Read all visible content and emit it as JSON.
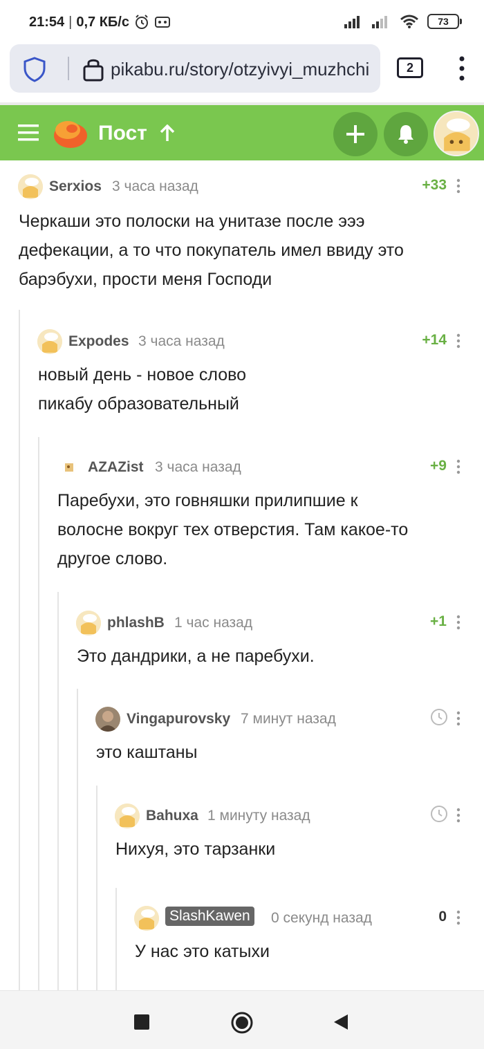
{
  "status_bar": {
    "time": "21:54",
    "speed": "0,7 КБ/с",
    "battery": "73"
  },
  "browser": {
    "url": "pikabu.ru/story/otzyivyi_muzhchi",
    "tab_count": "2"
  },
  "header": {
    "title": "Пост",
    "accent_color": "#7ac74f"
  },
  "comments": [
    {
      "author": "Serxios",
      "time": "3 часа назад",
      "rating": "+33",
      "lines": [
        "Черкаши это полоски на унитазе после эээ",
        "дефекации, а то что покупатель имел ввиду это",
        "барэбухи, прости меня Господи"
      ]
    },
    {
      "author": "Expodes",
      "time": "3 часа назад",
      "rating": "+14",
      "lines": [
        "новый день - новое слово",
        "пикабу образовательный"
      ]
    },
    {
      "author": "AZAZist",
      "time": "3 часа назад",
      "rating": "+9",
      "lines": [
        "Паребухи, это говняшки прилипшие к",
        "волосне вокруг тех отверстия. Там какое-то",
        "другое слово."
      ]
    },
    {
      "author": "phlashB",
      "time": "1 час назад",
      "rating": "+1",
      "lines": [
        "Это дандрики, а не паребухи."
      ]
    },
    {
      "author": "Vingapurovsky",
      "time": "7 минут назад",
      "rating": "",
      "lines": [
        "это каштаны"
      ]
    },
    {
      "author": "Bahuxa",
      "time": "1 минуту назад",
      "rating": "",
      "lines": [
        "Нихуя, это тарзанки"
      ]
    },
    {
      "author": "SlashKawen",
      "time": "0 секунд назад",
      "rating": "0",
      "lines": [
        "У нас это катыхи"
      ]
    }
  ]
}
